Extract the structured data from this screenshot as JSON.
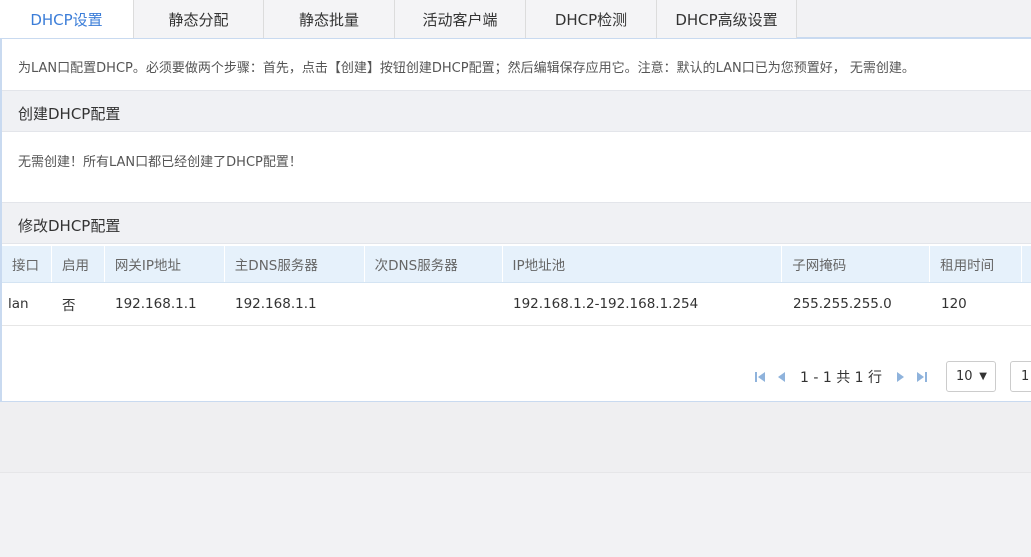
{
  "tabs": [
    {
      "label": "DHCP设置",
      "active": true
    },
    {
      "label": "静态分配",
      "active": false
    },
    {
      "label": "静态批量",
      "active": false
    },
    {
      "label": "活动客户端",
      "active": false
    },
    {
      "label": "DHCP检测",
      "active": false
    },
    {
      "label": "DHCP高级设置",
      "active": false
    }
  ],
  "notice": "为LAN口配置DHCP。必须要做两个步骤：首先，点击【创建】按钮创建DHCP配置；然后编辑保存应用它。注意：默认的LAN口已为您预置好， 无需创建。",
  "create_section": {
    "title": "创建DHCP配置",
    "message": "无需创建！所有LAN口都已经创建了DHCP配置！"
  },
  "modify_section": {
    "title": "修改DHCP配置"
  },
  "table": {
    "headers": [
      "接口",
      "启用",
      "网关IP地址",
      "主DNS服务器",
      "次DNS服务器",
      "IP地址池",
      "子网掩码",
      "租用时间"
    ],
    "rows": [
      [
        "lan",
        "否",
        "192.168.1.1",
        "192.168.1.1",
        "",
        "192.168.1.2-192.168.1.254",
        "255.255.255.0",
        "120"
      ]
    ]
  },
  "pager": {
    "summary": "1 - 1 共 1 行",
    "page_size": "10",
    "page_input": "1"
  },
  "colors": {
    "accent": "#3b7dd8",
    "header_bg": "#e6f1fb",
    "section_bg": "#f0f1f4",
    "pager_icon": "#8fb3dc"
  }
}
